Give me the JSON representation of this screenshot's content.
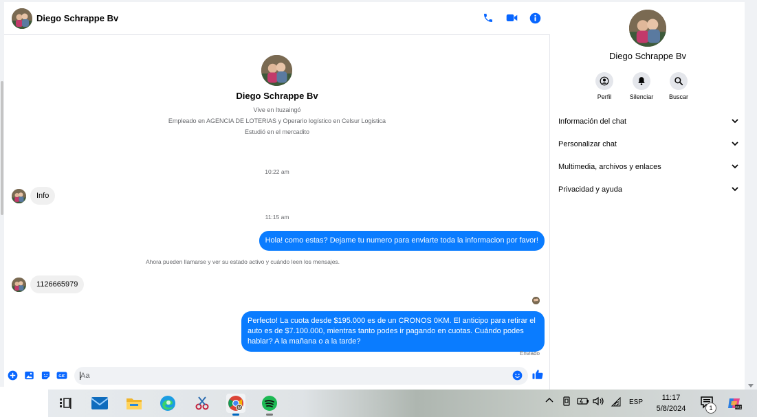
{
  "contact": {
    "name": "Diego Schrappe Bv",
    "lives": "Vive en Ituzaingó",
    "work": "Empleado en AGENCIA DE LOTERIAS y Operario logístico en Celsur Logistica",
    "study": "Estudió en el mercadito"
  },
  "header": {
    "call_icon": "phone-icon",
    "video_icon": "video-icon",
    "info_icon": "info-icon"
  },
  "messages": {
    "time1": "10:22 am",
    "in1": "Info",
    "time2": "11:15 am",
    "out1": "Hola! como estas? Dejame tu numero para enviarte toda la informacion por favor!",
    "system": "Ahora pueden llamarse y ver su estado activo y cuándo leen los mensajes.",
    "in2": "1126665979",
    "out2": "Perfecto! La cuota desde $195.000 es de un CRONOS 0KM. El anticipo para retirar el auto es de $7.100.000, mientras tanto podes ir pagando en cuotas. Cuándo podes hablar? A la mañana o a la tarde?",
    "status": "Enviado"
  },
  "composer": {
    "placeholder": "Aa"
  },
  "side": {
    "actions": [
      "Perfil",
      "Silenciar",
      "Buscar"
    ],
    "sections": [
      "Información del chat",
      "Personalizar chat",
      "Multimedia, archivos y enlaces",
      "Privacidad y ayuda"
    ]
  },
  "taskbar": {
    "language": "ESP",
    "time": "11:17",
    "date": "5/8/2024",
    "notifications": "1",
    "apps": [
      "task-view",
      "mail",
      "file-explorer",
      "edge",
      "snipping-tool",
      "chrome",
      "spotify"
    ]
  },
  "colors": {
    "accent": "#0a7cff",
    "icon_blue": "#0866ff"
  }
}
